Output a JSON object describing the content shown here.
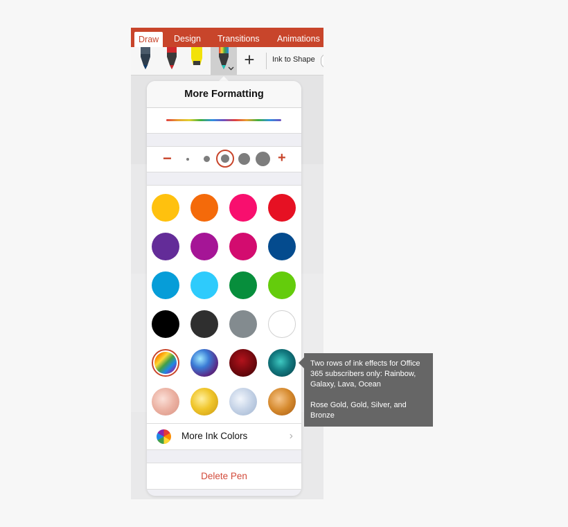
{
  "ribbon": {
    "tabs": [
      {
        "label": "Draw"
      },
      {
        "label": "Design"
      },
      {
        "label": "Transitions"
      },
      {
        "label": "Animations"
      }
    ],
    "ink_to_shape_label": "Ink to Shape",
    "add_label": "+"
  },
  "panel": {
    "title": "More Formatting",
    "size": {
      "minus": "−",
      "plus": "+",
      "selected_index": 2
    },
    "colors": [
      {
        "name": "yellow",
        "hex": "#ffc10e"
      },
      {
        "name": "orange",
        "hex": "#f46a0a"
      },
      {
        "name": "pink",
        "hex": "#f80f6e"
      },
      {
        "name": "red",
        "hex": "#e61123"
      },
      {
        "name": "purple",
        "hex": "#632c98"
      },
      {
        "name": "magenta",
        "hex": "#a51596"
      },
      {
        "name": "dark pink",
        "hex": "#d30c6f"
      },
      {
        "name": "dark blue",
        "hex": "#044b8e"
      },
      {
        "name": "blue",
        "hex": "#069dd8"
      },
      {
        "name": "light blue",
        "hex": "#2ecbfc"
      },
      {
        "name": "green",
        "hex": "#078e3c"
      },
      {
        "name": "lime",
        "hex": "#64cc0c"
      },
      {
        "name": "black",
        "hex": "#000000"
      },
      {
        "name": "dark gray",
        "hex": "#2f2f2f"
      },
      {
        "name": "gray",
        "hex": "#838b8f"
      },
      {
        "name": "white",
        "hex": "#ffffff"
      }
    ],
    "effects": [
      {
        "name": "Rainbow"
      },
      {
        "name": "Galaxy"
      },
      {
        "name": "Lava"
      },
      {
        "name": "Ocean"
      },
      {
        "name": "Rose Gold"
      },
      {
        "name": "Gold"
      },
      {
        "name": "Silver"
      },
      {
        "name": "Bronze"
      }
    ],
    "more_ink_colors": "More Ink Colors",
    "delete_pen": "Delete Pen"
  },
  "callout": {
    "line1": "Two rows of ink effects for Office 365 subscribers only: Rainbow, Galaxy, Lava, Ocean",
    "line2": "Rose Gold, Gold, Silver, and Bronze"
  },
  "theme": {
    "accent": "#c8452b",
    "delete_color": "#d24a3a"
  }
}
